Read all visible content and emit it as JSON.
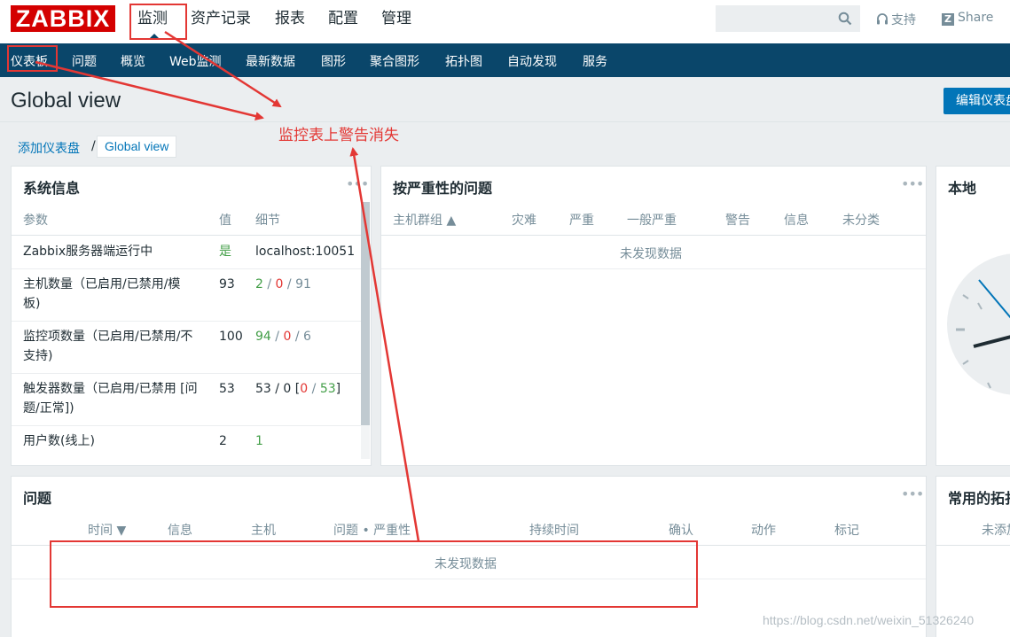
{
  "header": {
    "logo": "ZABBIX",
    "nav": [
      "监测",
      "资产记录",
      "报表",
      "配置",
      "管理"
    ],
    "search_placeholder": "",
    "support": "支持",
    "share_badge": "Z",
    "share": "Share"
  },
  "subnav": [
    "仪表板",
    "问题",
    "概览",
    "Web监测",
    "最新数据",
    "图形",
    "聚合图形",
    "拓扑图",
    "自动发现",
    "服务"
  ],
  "page": {
    "title": "Global view",
    "edit_button": "编辑仪表盘",
    "breadcrumb": [
      "添加仪表盘",
      "/",
      "Global view"
    ]
  },
  "sysinfo": {
    "title": "系统信息",
    "dots": "•••",
    "columns": [
      "参数",
      "值",
      "细节"
    ],
    "rows": [
      {
        "param": "Zabbix服务器端运行中",
        "value": "是",
        "detail": "localhost:10051"
      },
      {
        "param_l1": "主机数量（已启用/已禁用/模",
        "param_l2": "板)",
        "value": "93",
        "d1": "2",
        "d2": "0",
        "d3": "91"
      },
      {
        "param_l1": "监控项数量（已启用/已禁用/不",
        "param_l2": "支持)",
        "value": "100",
        "d1": "94",
        "d2": "0",
        "d3": "6"
      },
      {
        "param_l1": "触发器数量（已启用/已禁用 [问",
        "param_l2": "题/正常])",
        "value": "53",
        "d_prefix": "53 / 0 [",
        "d1": "0",
        "d2": "53",
        "d_suffix": "]"
      },
      {
        "param": "用户数(线上)",
        "value": "2",
        "detail": "1"
      }
    ]
  },
  "severity": {
    "title": "按严重性的问题",
    "dots": "•••",
    "columns": [
      "主机群组 ▲",
      "灾难",
      "严重",
      "一般严重",
      "警告",
      "信息",
      "未分类"
    ],
    "empty": "未发现数据"
  },
  "clock": {
    "title": "本地"
  },
  "problems": {
    "title": "问题",
    "dots": "•••",
    "columns": [
      "时间 ▼",
      "信息",
      "主机",
      "问题 • 严重性",
      "持续时间",
      "确认",
      "动作",
      "标记"
    ],
    "empty": "未发现数据"
  },
  "favmaps": {
    "title": "常用的拓扑图",
    "empty": "未添加"
  },
  "annotation": {
    "text": "监控表上警告消失"
  },
  "watermark": "https://blog.csdn.net/weixin_51326240",
  "colors": {
    "brand": "#d40000",
    "nav": "#0a466a",
    "accent": "#0275b8",
    "annotation": "#e33734"
  }
}
